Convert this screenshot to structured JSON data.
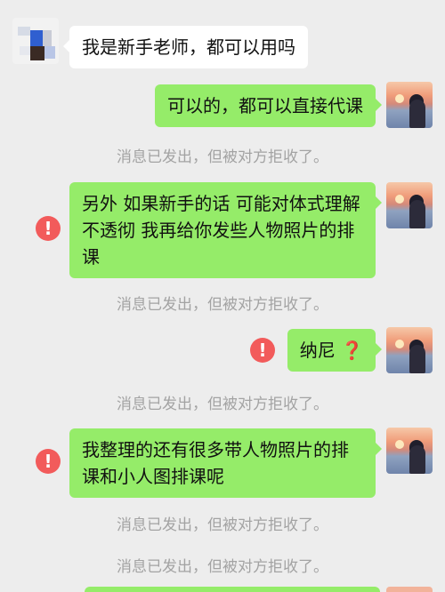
{
  "messages": [
    {
      "text": "我是新手老师，都可以用吗"
    },
    {
      "text": "可以的，都可以直接代课"
    },
    {
      "text": "另外  如果新手的话 可能对体式理解不透彻 我再给你发些人物照片的排课"
    },
    {
      "text": "纳尼",
      "emoji": "❓"
    },
    {
      "text": "我整理的还有很多带人物照片的排课和小人图排课呢"
    }
  ],
  "system_notice": "消息已发出，但被对方拒收了。",
  "error_glyph": "!",
  "colors": {
    "background": "#ededed",
    "sent_bubble": "#95ec69",
    "received_bubble": "#ffffff",
    "error_icon": "#f25b5b",
    "system_text": "#a3a3a3"
  }
}
